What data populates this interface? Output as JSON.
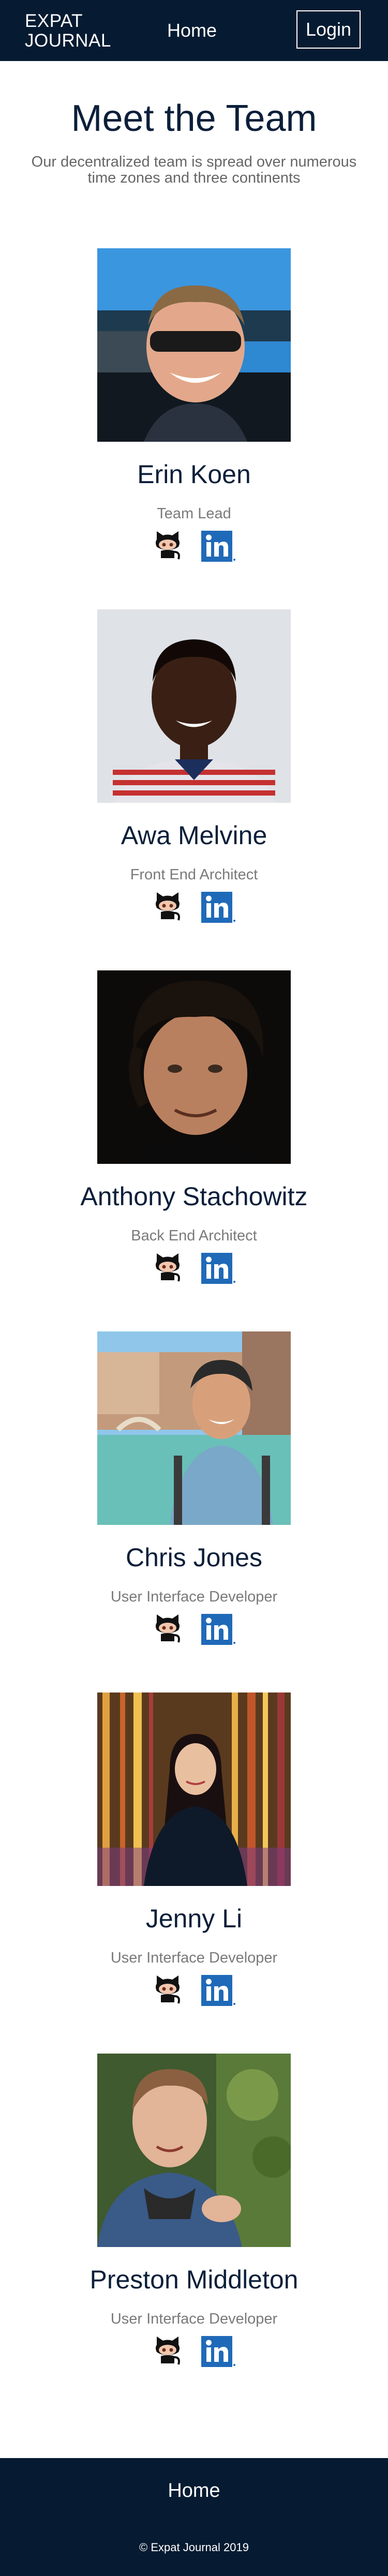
{
  "nav": {
    "logo_line1": "Expat",
    "logo_line2": "Journal",
    "home_label": "Home",
    "login_label": "Login"
  },
  "page": {
    "title": "Meet the Team",
    "subtitle": "Our decentralized team is spread over numerous time zones and three continents"
  },
  "team": [
    {
      "name": "Erin Koen",
      "role": "Team Lead"
    },
    {
      "name": "Awa Melvine",
      "role": "Front End Architect"
    },
    {
      "name": "Anthony Stachowitz",
      "role": "Back End Architect"
    },
    {
      "name": "Chris Jones",
      "role": "User Interface Developer"
    },
    {
      "name": "Jenny Li",
      "role": "User Interface Developer"
    },
    {
      "name": "Preston Middleton",
      "role": "User Interface Developer"
    }
  ],
  "icons": {
    "github": "github-icon",
    "linkedin": "linkedin-icon",
    "linkedin_text": "in"
  },
  "footer": {
    "home_label": "Home",
    "copyright": "© Expat Journal 2019"
  },
  "colors": {
    "navy": "#061b32",
    "linkedin_blue": "#1f6ab8"
  }
}
